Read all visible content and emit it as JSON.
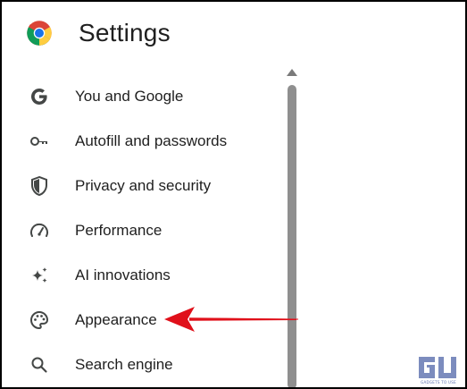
{
  "header": {
    "title": "Settings",
    "logo_icon": "chrome-logo-icon"
  },
  "nav": {
    "items": [
      {
        "label": "You and Google",
        "icon": "google-g-icon"
      },
      {
        "label": "Autofill and passwords",
        "icon": "key-icon"
      },
      {
        "label": "Privacy and security",
        "icon": "shield-icon"
      },
      {
        "label": "Performance",
        "icon": "speedometer-icon"
      },
      {
        "label": "AI innovations",
        "icon": "sparkle-icon"
      },
      {
        "label": "Appearance",
        "icon": "palette-icon"
      },
      {
        "label": "Search engine",
        "icon": "search-icon"
      }
    ]
  },
  "annotation": {
    "arrow_color": "#e0101a",
    "points_to": "Appearance"
  },
  "watermark": {
    "logo_text": "GU",
    "tagline": "GADGETS TO USE",
    "color": "#5b6fae"
  },
  "colors": {
    "text": "#1f1f1f",
    "icon": "#444746",
    "scrollbar": "#8f8f8f"
  }
}
